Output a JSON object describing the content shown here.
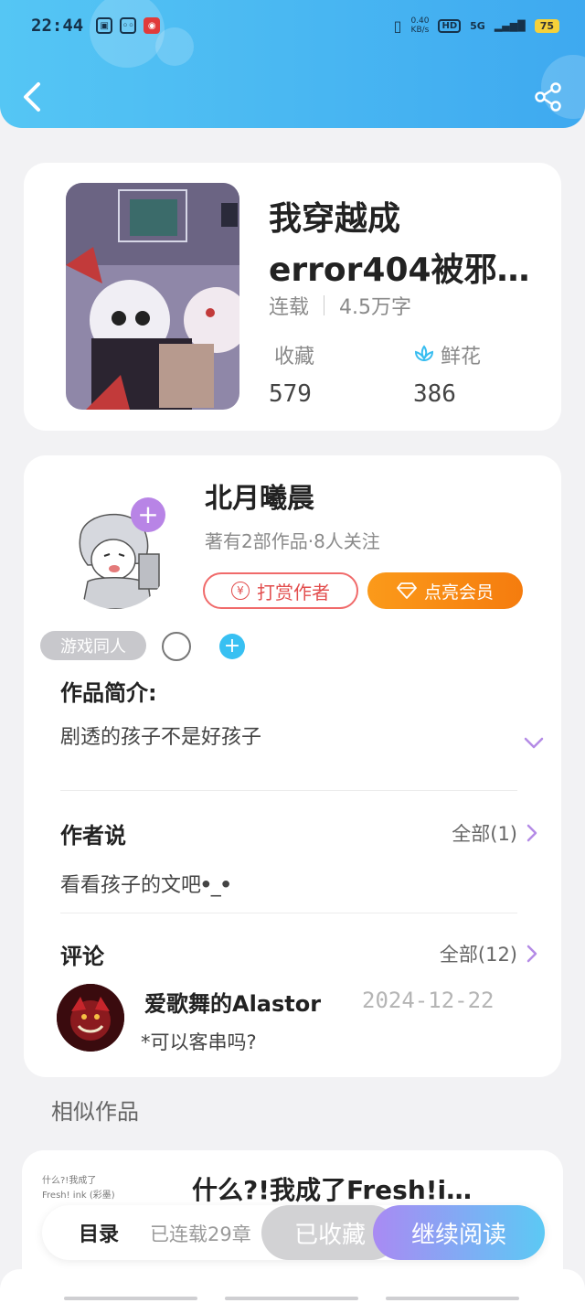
{
  "status_bar": {
    "time": "22:44",
    "net_speed_value": "0.40",
    "net_speed_unit": "KB/s",
    "hd": "HD",
    "signal": "5G",
    "battery": "75"
  },
  "book": {
    "title": "我穿越成error404被邪…",
    "status": "连载",
    "word_count": "4.5万字",
    "favorites_label": "收藏",
    "favorites_count": "579",
    "flowers_label": "鲜花",
    "flowers_count": "386"
  },
  "author": {
    "name": "北月曦晨",
    "info": "著有2部作品·8人关注",
    "reward_label": "打赏作者",
    "vip_label": "点亮会员",
    "tag": "游戏同人"
  },
  "intro": {
    "title": "作品简介:",
    "text": "剧透的孩子不是好孩子"
  },
  "author_says": {
    "title": "作者说",
    "more": "全部(1)",
    "text": "看看孩子的文吧ꔷ_ꔷ"
  },
  "comments": {
    "title": "评论",
    "more": "全部(12)",
    "items": [
      {
        "user": "爱歌舞的Alastor",
        "date": "2024-12-22",
        "text": "*可以客串吗?"
      }
    ]
  },
  "similar": {
    "title": "相似作品",
    "items": [
      {
        "title": "什么?!我成了Fresh!i…",
        "cover_text_1": "什么?!我成了",
        "cover_text_2": "Fresh! ink (彩墨)"
      }
    ]
  },
  "bottom_bar": {
    "toc": "目录",
    "serial": "已连载29章",
    "collected": "已收藏",
    "continue": "继续阅读"
  },
  "colors": {
    "header_start": "#55c6f4",
    "header_end": "#3ea9f0",
    "follow_plus": "#b884e6",
    "reward": "#e24d4d",
    "vip": "#f57c0e",
    "read_start": "#a98af3",
    "read_end": "#5cc9f4"
  },
  "icons": {
    "back": "chevron-left-icon",
    "share": "share-icon",
    "flower": "lotus-icon",
    "expand": "chevron-down-icon",
    "more": "chevron-right-icon"
  }
}
